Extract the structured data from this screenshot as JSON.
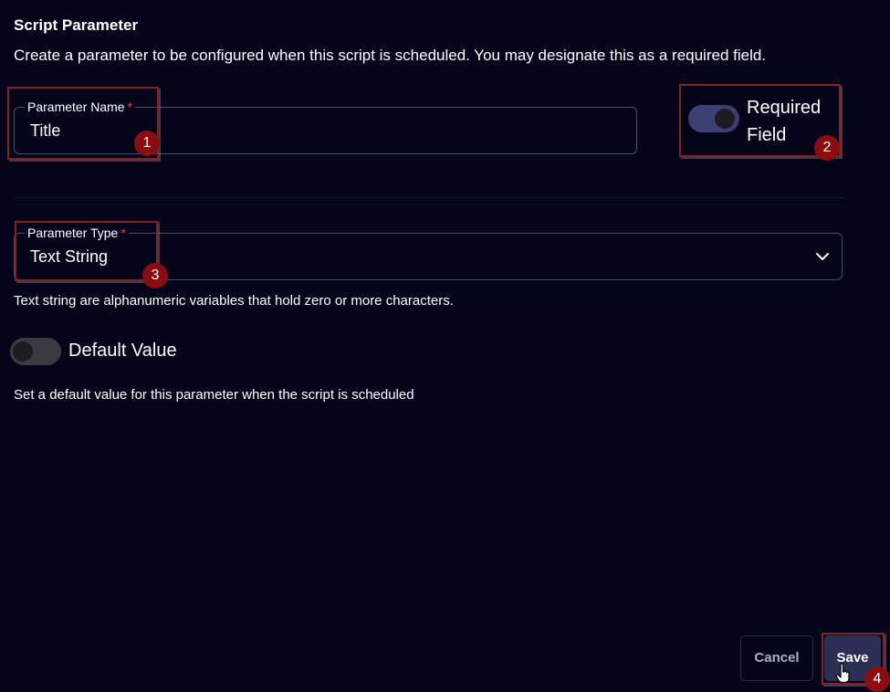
{
  "header": {
    "title": "Script Parameter",
    "description": "Create a parameter to be configured when this script is scheduled. You may designate this as a required field."
  },
  "parameter_name": {
    "label": "Parameter Name",
    "required_mark": "*",
    "value": "Title"
  },
  "required_field": {
    "label_line1": "Required",
    "label_line2": "Field",
    "enabled": true
  },
  "parameter_type": {
    "label": "Parameter Type",
    "required_mark": "*",
    "value": "Text String",
    "helper": "Text string are alphanumeric variables that hold zero or more characters."
  },
  "default_value": {
    "label": "Default Value",
    "enabled": false,
    "helper": "Set a default value for this parameter when the script is scheduled"
  },
  "actions": {
    "cancel_label": "Cancel",
    "save_label": "Save"
  },
  "annotations": {
    "step1": "1",
    "step2": "2",
    "step3": "3",
    "step4": "4"
  },
  "colors": {
    "background": "#04041a",
    "toggle_on": "#3b3f73",
    "toggle_off": "#3a3a40",
    "save_button": "#2b2f55",
    "annotation": "#8b0d10",
    "required_star": "#e0463f"
  },
  "icons": {
    "dropdown": "chevron-down-icon",
    "cursor": "hand-pointer-icon"
  }
}
